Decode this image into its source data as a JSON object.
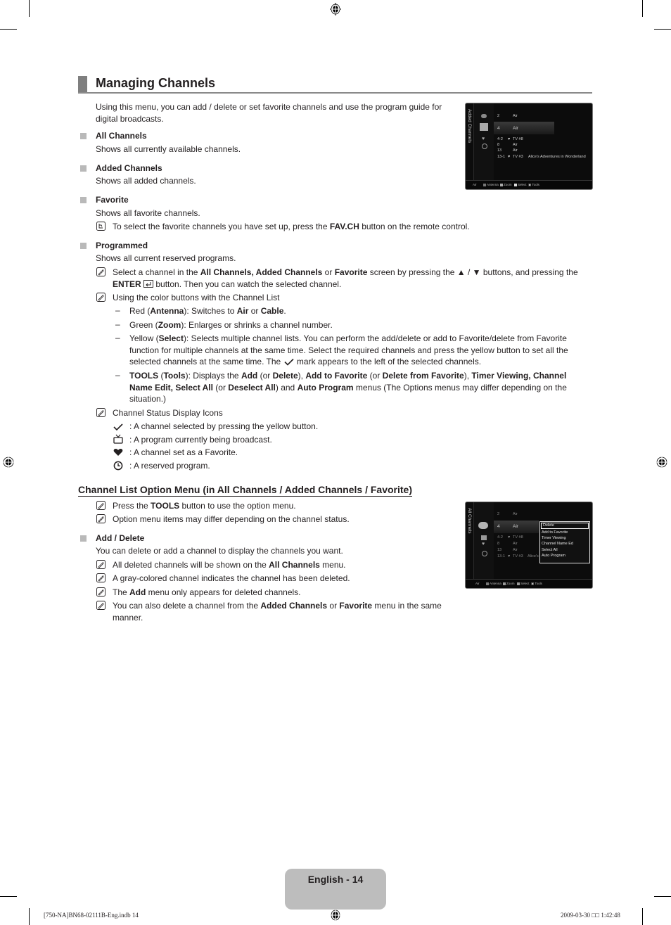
{
  "page": {
    "title": "Managing Channels",
    "intro": "Using this menu, you can add / delete or set favorite channels and use the program guide for digital broadcasts.",
    "sections": [
      {
        "heading": "All Channels",
        "body": "Shows all currently available channels."
      },
      {
        "heading": "Added Channels",
        "body": "Shows all added channels."
      },
      {
        "heading": "Favorite",
        "body": "Shows all favorite channels.",
        "note": {
          "pre": "To select the favorite channels you have set up, press the ",
          "bold": "FAV.CH",
          "post": " button on the remote control."
        }
      },
      {
        "heading": "Programmed",
        "body": "Shows all current reserved programs."
      }
    ],
    "programmed_notes": {
      "select": {
        "t1": "Select a channel in the ",
        "b1": "All Channels, Added Channels",
        "t2": " or ",
        "b2": "Favorite",
        "t3": " screen by pressing the ▲ / ▼ buttons, and pressing the",
        "b3": "ENTER",
        "t4": " button. Then you can watch the selected channel."
      },
      "color_intro": "Using the color buttons with the Channel List",
      "red": {
        "t1": "Red (",
        "b1": "Antenna",
        "t2": "): Switches to ",
        "b2": "Air",
        "t3": " or ",
        "b3": "Cable",
        "t4": "."
      },
      "green": {
        "t1": "Green (",
        "b1": "Zoom",
        "t2": "): Enlarges or shrinks a channel number."
      },
      "yellow": {
        "t1": "Yellow (",
        "b1": "Select",
        "t2": "): Selects multiple channel lists. You can perform the add/delete or add to Favorite/delete from Favorite",
        "line2": "function for multiple channels at the same time. Select the required channels and press the yellow button to set all the",
        "line3a": "selected channels at the same time. The",
        "line3b": "mark appears to the left of the selected channels."
      },
      "tools": {
        "b1": "TOOLS",
        "t1": " (",
        "b2": "Tools",
        "t2": "): Displays the ",
        "b3": "Add",
        "t3": " (or ",
        "b4": "Delete",
        "t4": "), ",
        "b5": "Add to Favorite",
        "t5": " (or ",
        "b6": "Delete from Favorite",
        "t6": "), ",
        "b7": "Timer Viewing, Channel",
        "b8": "Name Edit, Select All",
        "t7": " (or ",
        "b9": "Deselect All",
        "t8": ") and ",
        "b10": "Auto Program",
        "t9": " menus (The Options menus may differ depending on the",
        "t10": "situation.)"
      },
      "status_intro": "Channel Status Display Icons",
      "status_icons": [
        {
          "icon": "check-icon",
          "text": ": A channel selected by pressing the yellow button."
        },
        {
          "icon": "tv-icon",
          "text": ": A program currently being broadcast."
        },
        {
          "icon": "heart-icon",
          "text": ": A channel set as a Favorite."
        },
        {
          "icon": "clock-icon",
          "text": ": A reserved program."
        }
      ]
    },
    "option_menu": {
      "title": "Channel List Option Menu (in All Channels / Added Channels / Favorite)",
      "note1": {
        "pre": "Press the ",
        "bold": "TOOLS",
        "post": " button to use the option menu."
      },
      "note2": "Option menu items may differ depending on the channel status.",
      "add_delete": {
        "heading": "Add / Delete",
        "body": "You can delete or add a channel to display the channels you want.",
        "n1": {
          "pre": "All deleted channels will be shown on the ",
          "bold": "All Channels",
          "post": " menu."
        },
        "n2": "A gray-colored channel indicates the channel has been deleted.",
        "n3": {
          "pre": "The ",
          "bold": "Add",
          "post": " menu only appears for deleted channels."
        },
        "n4": {
          "pre": "You can also delete a channel from the ",
          "b1": "Added Channels",
          "mid": " or ",
          "b2": "Favorite",
          "post": " menu in the same",
          "line2": "manner."
        }
      }
    },
    "footer": {
      "page_label": "English - 14",
      "slug_left": "[750-NA]BN68-02111B-Eng.indb   14",
      "slug_right": "2009-03-30   □□ 1:42:48"
    }
  },
  "screens": {
    "added": {
      "side_title": "Added Channels",
      "rows": [
        {
          "num": "2",
          "fav": "",
          "name": "Air",
          "prog": ""
        },
        {
          "num": "4",
          "fav": "",
          "name": "Air",
          "prog": ""
        },
        {
          "num": "4-2",
          "fav": "♥",
          "name": "TV #8",
          "prog": ""
        },
        {
          "num": "8",
          "fav": "",
          "name": "Air",
          "prog": ""
        },
        {
          "num": "13",
          "fav": "",
          "name": "Air",
          "prog": ""
        },
        {
          "num": "13-1",
          "fav": "♥",
          "name": "TV #3",
          "prog": "Alice's Adventures in Wonderland"
        }
      ],
      "footer": {
        "source": "Air",
        "red": "Antenna",
        "green": "Zoom",
        "yellow": "Select",
        "tools": "Tools"
      }
    },
    "all": {
      "side_title": "All Channels",
      "rows": [
        {
          "num": "2",
          "fav": "",
          "name": "Air",
          "prog": ""
        },
        {
          "num": "4",
          "fav": "",
          "name": "Air",
          "prog": ""
        },
        {
          "num": "4-2",
          "fav": "♥",
          "name": "TV #8",
          "prog": ""
        },
        {
          "num": "8",
          "fav": "",
          "name": "Air",
          "prog": ""
        },
        {
          "num": "13",
          "fav": "",
          "name": "Air",
          "prog": ""
        },
        {
          "num": "13-1",
          "fav": "♥",
          "name": "TV #3",
          "prog": "Alice's"
        }
      ],
      "menu": [
        "Delete",
        "Add to Favorite",
        "Timer Viewing",
        "Channel Name Ed",
        "Select All",
        "Auto Program"
      ],
      "footer": {
        "source": "Air",
        "red": "Antenna",
        "green": "Zoom",
        "yellow": "Select",
        "tools": "Tools"
      }
    }
  }
}
